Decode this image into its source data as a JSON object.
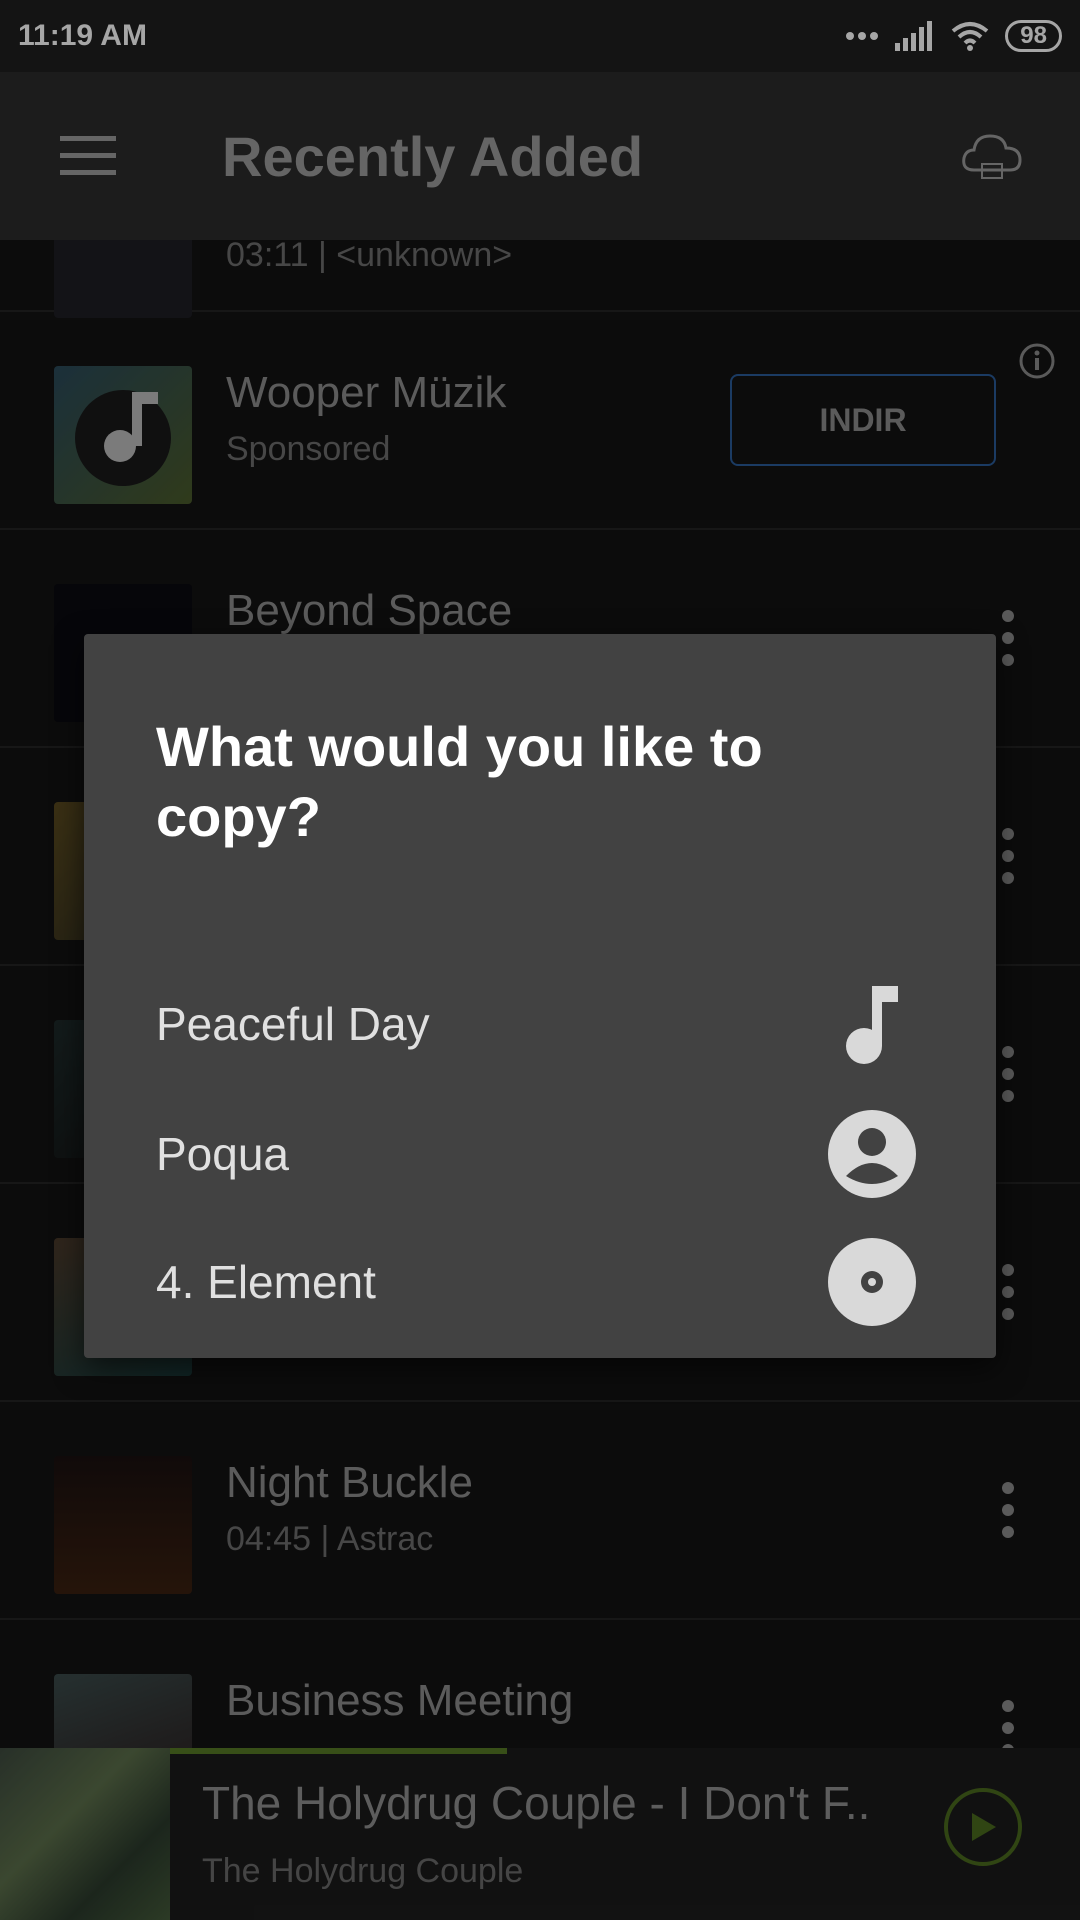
{
  "status": {
    "time": "11:19 AM",
    "battery": "98"
  },
  "appbar": {
    "title": "Recently Added"
  },
  "list": {
    "partial_top": {
      "subtitle": "03:11 | <unknown>"
    },
    "ad": {
      "title": "Wooper Müzik",
      "subtitle": "Sponsored",
      "cta": "INDIR"
    },
    "items": [
      {
        "title": "Beyond Space",
        "subtitle": ""
      },
      {
        "title": "",
        "subtitle": ""
      },
      {
        "title": "",
        "subtitle": ""
      },
      {
        "title": "",
        "subtitle": ""
      },
      {
        "title": "Night Buckle",
        "subtitle": "04:45 | Astrac"
      },
      {
        "title": "Business Meeting",
        "subtitle": ""
      }
    ]
  },
  "player": {
    "song": "The Holydrug Couple - I Don't F..",
    "artist": "The Holydrug Couple",
    "progress": 0.37
  },
  "dialog": {
    "title": "What would you like to copy?",
    "options": [
      {
        "label": "Peaceful Day",
        "icon": "music-note-icon"
      },
      {
        "label": "Poqua",
        "icon": "artist-icon"
      },
      {
        "label": "4. Element",
        "icon": "album-disc-icon"
      }
    ]
  },
  "colors": {
    "accent": "#567a25",
    "dialog_bg": "#424242",
    "ad_border": "#2a5b99"
  }
}
